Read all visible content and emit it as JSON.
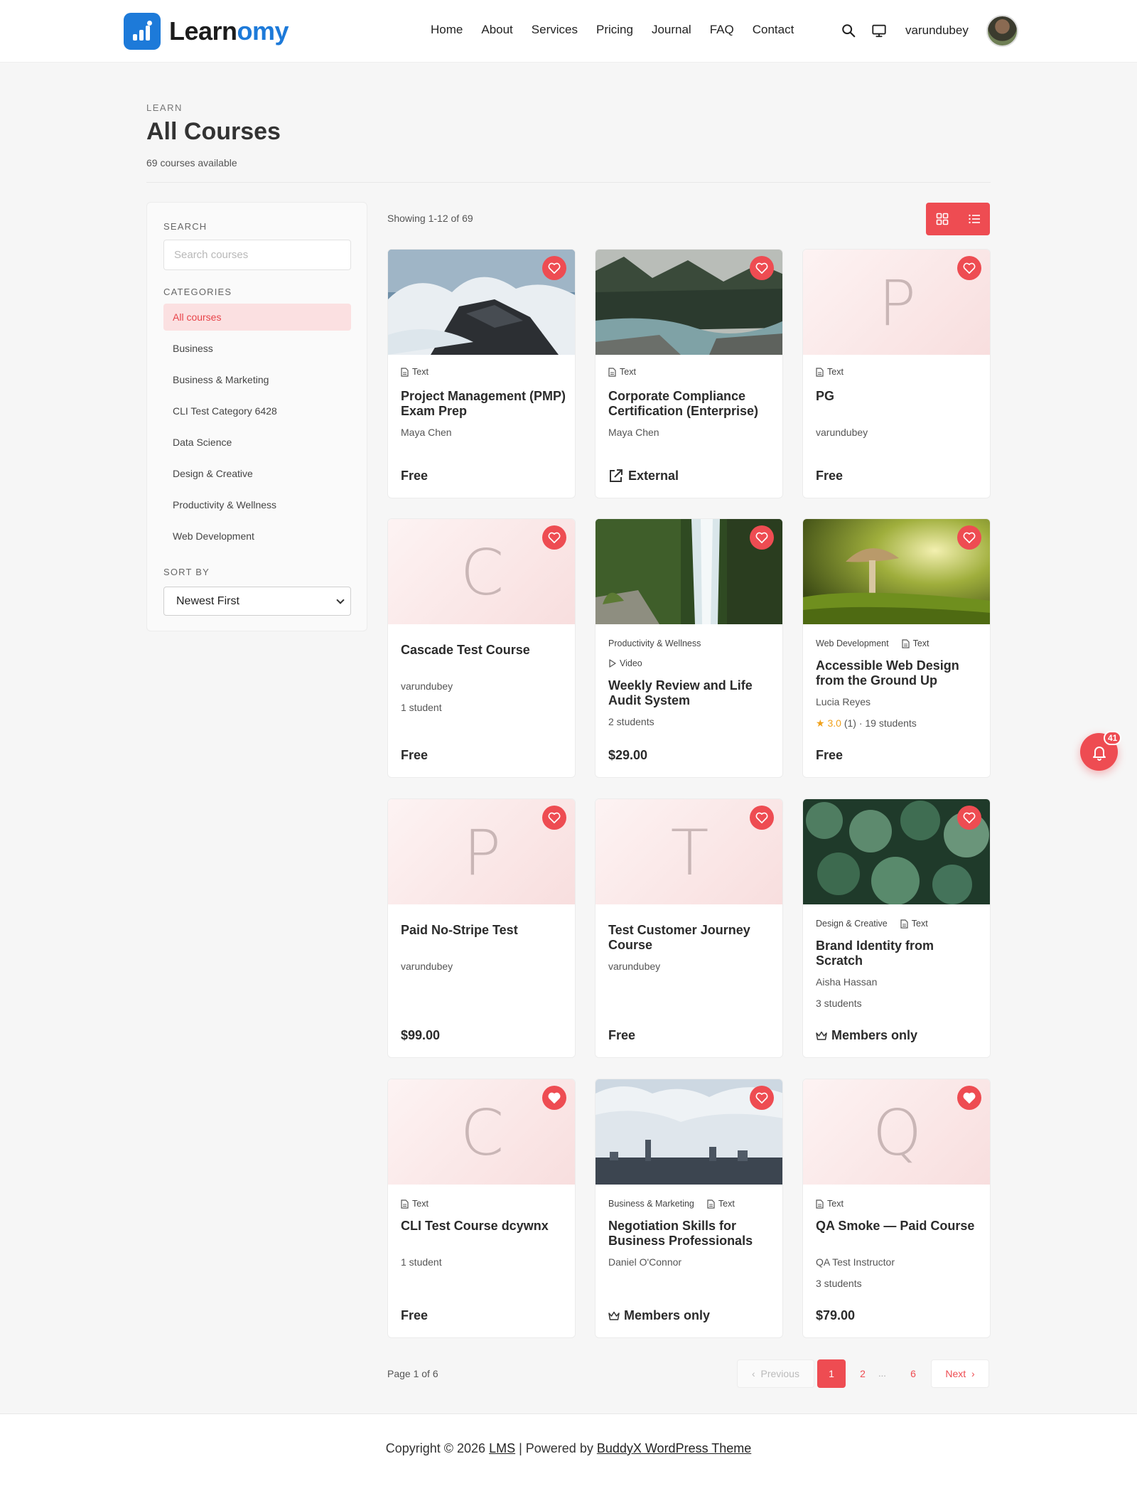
{
  "brand": {
    "name_part1": "Learn",
    "name_part2": "omy"
  },
  "nav": [
    "Home",
    "About",
    "Services",
    "Pricing",
    "Journal",
    "FAQ",
    "Contact"
  ],
  "user": {
    "name": "varundubey"
  },
  "page": {
    "eyebrow": "LEARN",
    "title": "All Courses",
    "subtitle": "69 courses available"
  },
  "sidebar": {
    "search_label": "SEARCH",
    "search_placeholder": "Search courses",
    "categories_label": "CATEGORIES",
    "categories": [
      "All courses",
      "Business",
      "Business & Marketing",
      "CLI Test Category 6428",
      "Data Science",
      "Design & Creative",
      "Productivity & Wellness",
      "Web Development"
    ],
    "sort_label": "SORT BY",
    "sort_value": "Newest First"
  },
  "results": {
    "showing": "Showing 1-12 of 69"
  },
  "courses": [
    {
      "thumb": "photo-waves",
      "category": "",
      "type": "Text",
      "title": "Project Management (PMP) Exam Prep",
      "instructor": "Maya Chen",
      "students": "",
      "rating": "",
      "price": "Free"
    },
    {
      "thumb": "photo-river",
      "category": "",
      "type": "Text",
      "title": "Corporate Compliance Certification (Enterprise)",
      "instructor": "Maya Chen",
      "students": "",
      "rating": "",
      "price": "External"
    },
    {
      "thumb": "letter",
      "letter": "P",
      "category": "",
      "type": "Text",
      "title": "PG",
      "instructor": "varundubey",
      "students": "",
      "rating": "",
      "price": "Free"
    },
    {
      "thumb": "letter",
      "letter": "C",
      "category": "",
      "type": "",
      "title": "Cascade Test Course",
      "instructor": "varundubey",
      "students": "1 student",
      "rating": "",
      "price": "Free"
    },
    {
      "thumb": "photo-waterfall",
      "category": "Productivity & Wellness",
      "type": "Video",
      "title": "Weekly Review and Life Audit System",
      "instructor": "",
      "students": "2 students",
      "rating": "",
      "price": "$29.00"
    },
    {
      "thumb": "photo-mushroom",
      "category": "Web Development",
      "type": "Text",
      "title": "Accessible Web Design from the Ground Up",
      "instructor": "Lucia Reyes",
      "students": "19 students",
      "rating": "3.0",
      "rating_count": "(1)",
      "price": "Free"
    },
    {
      "thumb": "letter",
      "letter": "P",
      "category": "",
      "type": "",
      "title": "Paid No-Stripe Test",
      "instructor": "varundubey",
      "students": "",
      "rating": "",
      "price": "$99.00"
    },
    {
      "thumb": "letter",
      "letter": "T",
      "category": "",
      "type": "",
      "title": "Test Customer Journey Course",
      "instructor": "varundubey",
      "students": "",
      "rating": "",
      "price": "Free"
    },
    {
      "thumb": "photo-succulents",
      "category": "Design & Creative",
      "type": "Text",
      "title": "Brand Identity from Scratch",
      "instructor": "Aisha Hassan",
      "students": "3 students",
      "rating": "",
      "price": "Members only"
    },
    {
      "thumb": "letter",
      "letter": "C",
      "category": "",
      "type": "Text",
      "title": "CLI Test Course dcywnx",
      "instructor": "",
      "students": "1 student",
      "rating": "",
      "price": "Free"
    },
    {
      "thumb": "photo-skyline",
      "category": "Business & Marketing",
      "type": "Text",
      "title": "Negotiation Skills for Business Professionals",
      "instructor": "Daniel O'Connor",
      "students": "",
      "rating": "",
      "price": "Members only"
    },
    {
      "thumb": "letter",
      "letter": "Q",
      "category": "",
      "type": "Text",
      "title": "QA Smoke — Paid Course",
      "instructor": "QA Test Instructor",
      "students": "3 students",
      "rating": "",
      "price": "$79.00"
    }
  ],
  "pagination": {
    "page_of": "Page 1 of 6",
    "previous": "Previous",
    "pages": [
      "1",
      "2",
      "6"
    ],
    "dots": "...",
    "next": "Next"
  },
  "footer": {
    "prefix": "Copyright © 2026",
    "site_link": "LMS",
    "separator": "| Powered by",
    "theme_link": "BuddyX WordPress Theme"
  },
  "notifications": {
    "count": "41"
  },
  "colors": {
    "accent": "#ee4c52",
    "brand": "#1d7ad9",
    "active_bg": "#fbe0e1"
  }
}
